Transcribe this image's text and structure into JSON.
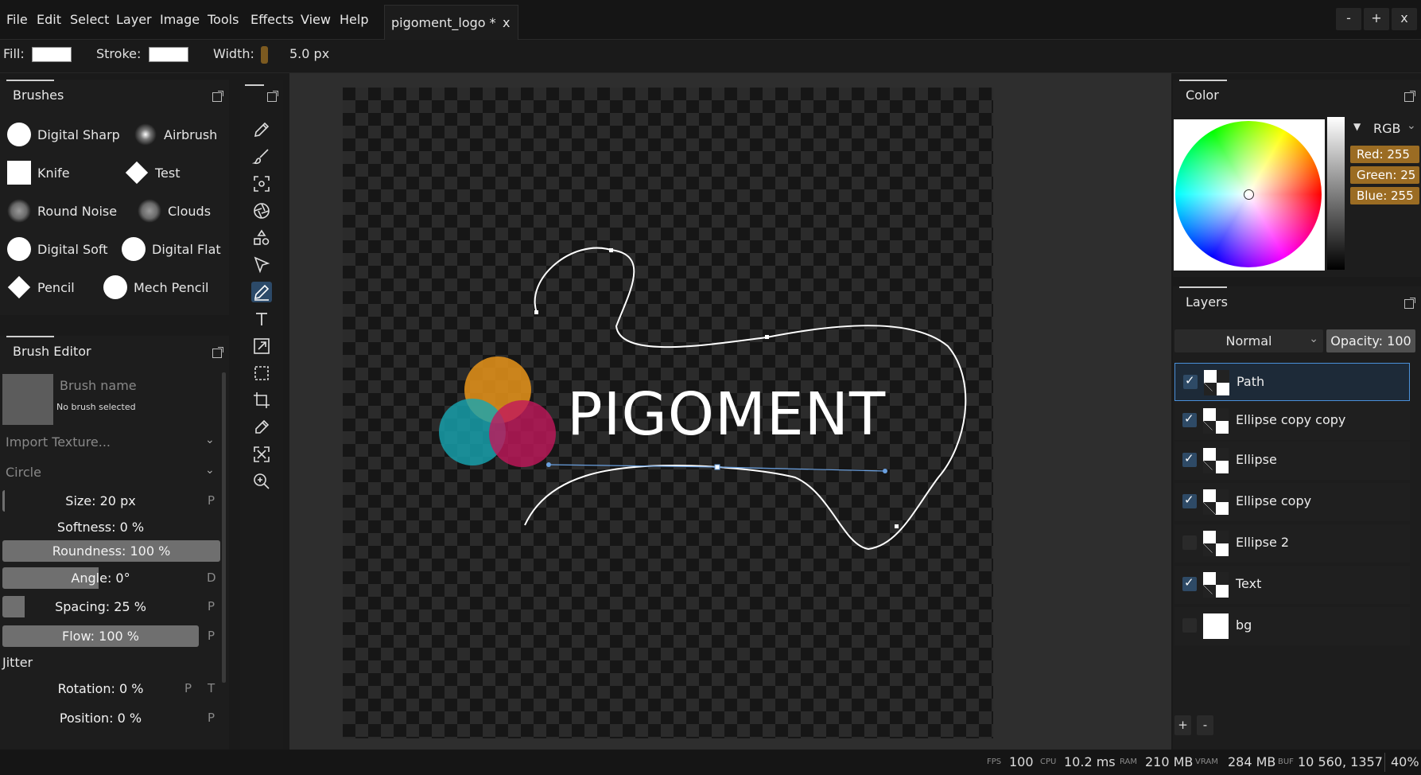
{
  "menubar": {
    "items": [
      "File",
      "Edit",
      "Select",
      "Layer",
      "Image",
      "Tools",
      "Effects",
      "View",
      "Help"
    ],
    "tab_title": "pigoment_logo *",
    "tab_close": "x",
    "win_minimize": "-",
    "win_maximize": "+",
    "win_close": "x"
  },
  "options": {
    "fill_label": "Fill:",
    "fill_color": "#ffffff",
    "stroke_label": "Stroke:",
    "stroke_color": "#ffffff",
    "width_label": "Width:",
    "width_value": "5.0 px"
  },
  "brushes": {
    "title": "Brushes",
    "items": [
      {
        "label": "Digital Sharp",
        "icon": "circle-hard"
      },
      {
        "label": "Airbrush",
        "icon": "circle-soft"
      },
      {
        "label": "Knife",
        "icon": "square"
      },
      {
        "label": "Test",
        "icon": "diamond"
      },
      {
        "label": "Round Noise",
        "icon": "noise"
      },
      {
        "label": "Clouds",
        "icon": "noise"
      },
      {
        "label": "Digital Soft",
        "icon": "circle-hard"
      },
      {
        "label": "Digital Flat",
        "icon": "circle-hard"
      },
      {
        "label": "Pencil",
        "icon": "diamond"
      },
      {
        "label": "Mech Pencil",
        "icon": "circle-hard"
      }
    ]
  },
  "brush_editor": {
    "title": "Brush Editor",
    "name_placeholder": "Brush name",
    "no_selection": "No brush selected",
    "texture_select": "Import Texture...",
    "shape_select": "Circle",
    "size": "Size: 20 px",
    "softness": "Softness: 0 %",
    "roundness": "Roundness: 100 %",
    "roundness_fraction": 1.0,
    "angle": "Angle: 0°",
    "spacing": "Spacing: 25 %",
    "flow": "Flow: 100 %",
    "flow_fraction": 1.0,
    "jitter_label": "Jitter",
    "rotation": "Rotation: 0 %",
    "position": "Position: 0 %",
    "pressure_flag": "P",
    "direction_flag": "D",
    "tilt_flag": "T"
  },
  "tools": [
    "pencil-icon",
    "brush-icon",
    "magic-select-icon",
    "shutter-icon",
    "shapes-icon",
    "path-select-icon",
    "pen-icon",
    "text-icon",
    "transform-icon",
    "rect-select-icon",
    "crop-icon",
    "eyedropper-icon",
    "fit-view-icon",
    "zoom-icon"
  ],
  "canvas": {
    "logo_text": "PIGOMENT",
    "circle_colors": [
      "#e8941a",
      "#17a6b3",
      "#c2185b"
    ]
  },
  "color_panel": {
    "title": "Color",
    "mode": "RGB",
    "red": "Red: 255",
    "green": "Green: 25",
    "blue": "Blue: 255"
  },
  "layers_panel": {
    "title": "Layers",
    "blend_mode": "Normal",
    "opacity": "Opacity: 100",
    "items": [
      {
        "name": "Path",
        "visible": true,
        "selected": true
      },
      {
        "name": "Ellipse copy copy",
        "visible": true
      },
      {
        "name": "Ellipse",
        "visible": true
      },
      {
        "name": "Ellipse copy",
        "visible": true
      },
      {
        "name": "Ellipse 2",
        "visible": false
      },
      {
        "name": "Text",
        "visible": true
      },
      {
        "name": "bg",
        "visible": false
      }
    ],
    "add_label": "+",
    "remove_label": "-"
  },
  "status": {
    "fps_key": "FPS",
    "fps": "100",
    "cpu_key": "CPU",
    "cpu": "10.2 ms",
    "ram_key": "RAM",
    "ram": "210 MB",
    "vram_key": "VRAM",
    "vram": "284 MB",
    "buf_key": "BUF",
    "buf": "10 560, 1357",
    "zoom": "40%"
  }
}
